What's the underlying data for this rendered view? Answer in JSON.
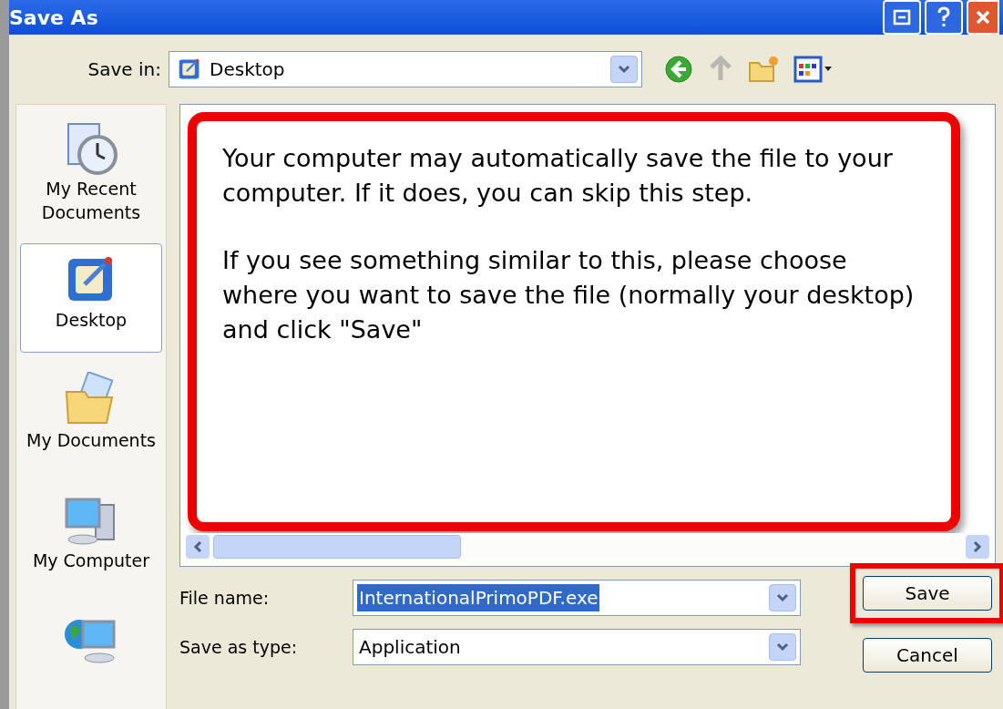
{
  "window": {
    "title": "Save As"
  },
  "save_in": {
    "label": "Save in:",
    "value": "Desktop"
  },
  "places": [
    {
      "label": "My Recent Documents",
      "kind": "recent",
      "selected": false
    },
    {
      "label": "Desktop",
      "kind": "desktop",
      "selected": true
    },
    {
      "label": "My Documents",
      "kind": "documents",
      "selected": false
    },
    {
      "label": "My Computer",
      "kind": "computer",
      "selected": false
    },
    {
      "kind": "network",
      "selected": false
    }
  ],
  "callout": {
    "paragraphs": [
      "Your computer may automatically save the file to your computer. If it does, you can skip this step.",
      "If you see something similar to this, please choose where you want to save the file (normally your desktop) and click \"Save\""
    ]
  },
  "fields": [
    {
      "label": "File name:",
      "value": "InternationalPrimoPDF.exe",
      "selected": true
    },
    {
      "label": "Save as type:",
      "value": "Application",
      "selected": false
    }
  ],
  "buttons": [
    {
      "label": "Save",
      "highlighted": true
    },
    {
      "label": "Cancel",
      "highlighted": false
    }
  ]
}
